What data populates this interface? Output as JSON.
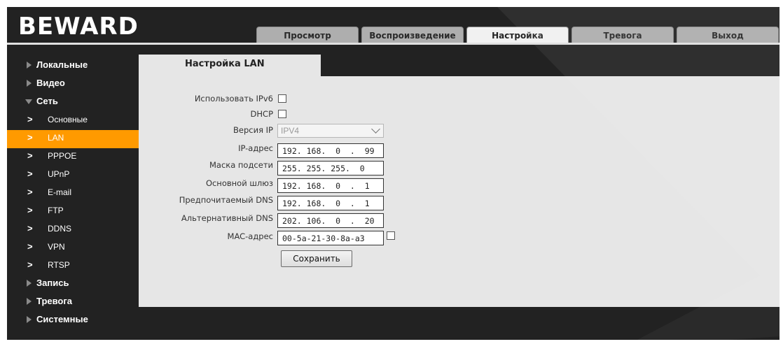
{
  "brand": {
    "logo_text": "BEWARD"
  },
  "tabs": [
    {
      "label": "Просмотр"
    },
    {
      "label": "Воспроизведение"
    },
    {
      "label": "Настройка",
      "active": true
    },
    {
      "label": "Тревога"
    },
    {
      "label": "Выход"
    }
  ],
  "sidebar": {
    "local": "Локальные",
    "video": "Видео",
    "network": "Сеть",
    "sub": [
      "Основные",
      "LAN",
      "PPPOE",
      "UPnP",
      "E-mail",
      "FTP",
      "DDNS",
      "VPN",
      "RTSP"
    ],
    "active_sub": "LAN",
    "record": "Запись",
    "alarm": "Тревога",
    "system": "Системные"
  },
  "panel": {
    "title": "Настройка LAN",
    "use_ipv6_label": "Использовать IPv6",
    "dhcp_label": "DHCP",
    "ip_version_label": "Версия IP",
    "ip_version_value": "IPV4",
    "ip_label": "IP-адрес",
    "ip_value": "192. 168.  0  .  99",
    "mask_label": "Маска подсети",
    "mask_value": "255. 255. 255.  0",
    "gateway_label": "Основной шлюз",
    "gateway_value": "192. 168.  0  .  1",
    "dns1_label": "Предпочитаемый DNS",
    "dns1_value": "192. 168.  0  .  1",
    "dns2_label": "Альтернативный DNS",
    "dns2_value": "202. 106.  0  .  20",
    "mac_label": "MAC-адрес",
    "mac_value": "00-5a-21-30-8a-a3",
    "save_label": "Сохранить"
  },
  "colors": {
    "frame_bg": "#222222",
    "panel_bg": "#e6e6e6",
    "active_item": "#ff9a00",
    "tab_bg": "#aeaeae",
    "tab_active_bg": "#f1f1f1"
  }
}
